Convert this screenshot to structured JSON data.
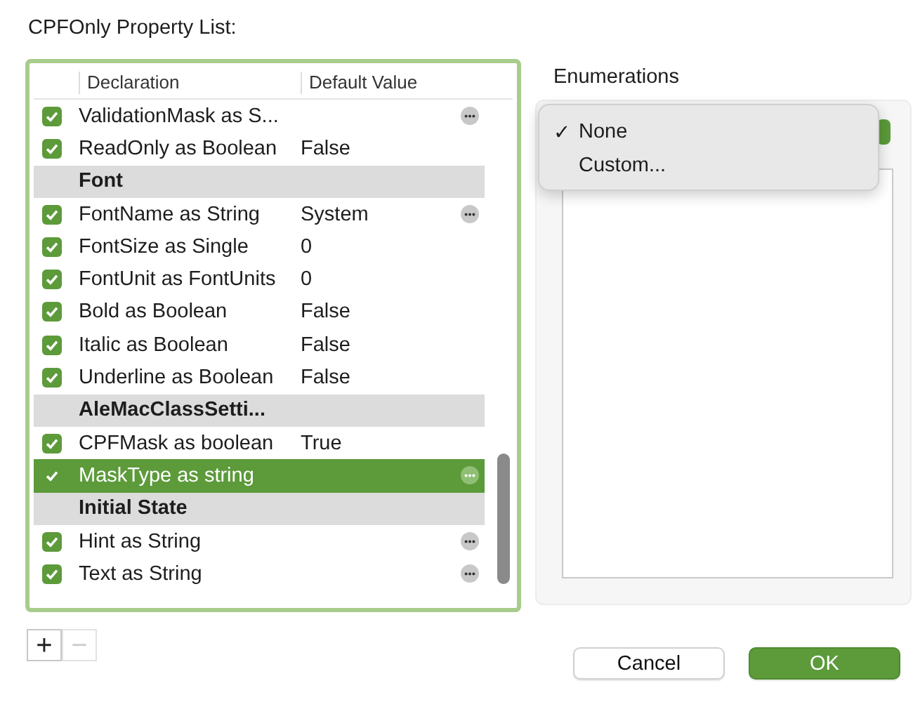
{
  "title": "CPFOnly Property List:",
  "table": {
    "columns": [
      "Declaration",
      "Default Value"
    ],
    "rows": [
      {
        "kind": "property",
        "declaration": "ValidationMask as S...",
        "value": "",
        "checked": true,
        "selected": false,
        "more": true
      },
      {
        "kind": "property",
        "declaration": "ReadOnly as Boolean",
        "value": "False",
        "checked": true,
        "selected": false,
        "more": false
      },
      {
        "kind": "group",
        "declaration": "Font"
      },
      {
        "kind": "property",
        "declaration": "FontName as String",
        "value": "System",
        "checked": true,
        "selected": false,
        "more": true
      },
      {
        "kind": "property",
        "declaration": "FontSize as Single",
        "value": "0",
        "checked": true,
        "selected": false,
        "more": false
      },
      {
        "kind": "property",
        "declaration": "FontUnit as FontUnits",
        "value": "0",
        "checked": true,
        "selected": false,
        "more": false
      },
      {
        "kind": "property",
        "declaration": "Bold as Boolean",
        "value": "False",
        "checked": true,
        "selected": false,
        "more": false
      },
      {
        "kind": "property",
        "declaration": "Italic as Boolean",
        "value": "False",
        "checked": true,
        "selected": false,
        "more": false
      },
      {
        "kind": "property",
        "declaration": "Underline as Boolean",
        "value": "False",
        "checked": true,
        "selected": false,
        "more": false
      },
      {
        "kind": "group",
        "declaration": "AleMacClassSetti..."
      },
      {
        "kind": "property",
        "declaration": "CPFMask as boolean",
        "value": "True",
        "checked": true,
        "selected": false,
        "more": false
      },
      {
        "kind": "property",
        "declaration": "MaskType as string",
        "value": "",
        "checked": true,
        "selected": true,
        "more": true
      },
      {
        "kind": "group",
        "declaration": "Initial State"
      },
      {
        "kind": "property",
        "declaration": "Hint as String",
        "value": "",
        "checked": true,
        "selected": false,
        "more": true
      },
      {
        "kind": "property",
        "declaration": "Text as String",
        "value": "",
        "checked": true,
        "selected": false,
        "more": true
      }
    ]
  },
  "list_buttons": [
    "+",
    "−"
  ],
  "enumerations": {
    "title": "Enumerations",
    "check_mark": "✓",
    "menu": [
      {
        "label": "None",
        "selected": true
      },
      {
        "label": "Custom...",
        "selected": false
      }
    ]
  },
  "buttons": [
    {
      "label": "Cancel",
      "default": false
    },
    {
      "label": "OK",
      "default": true
    }
  ]
}
